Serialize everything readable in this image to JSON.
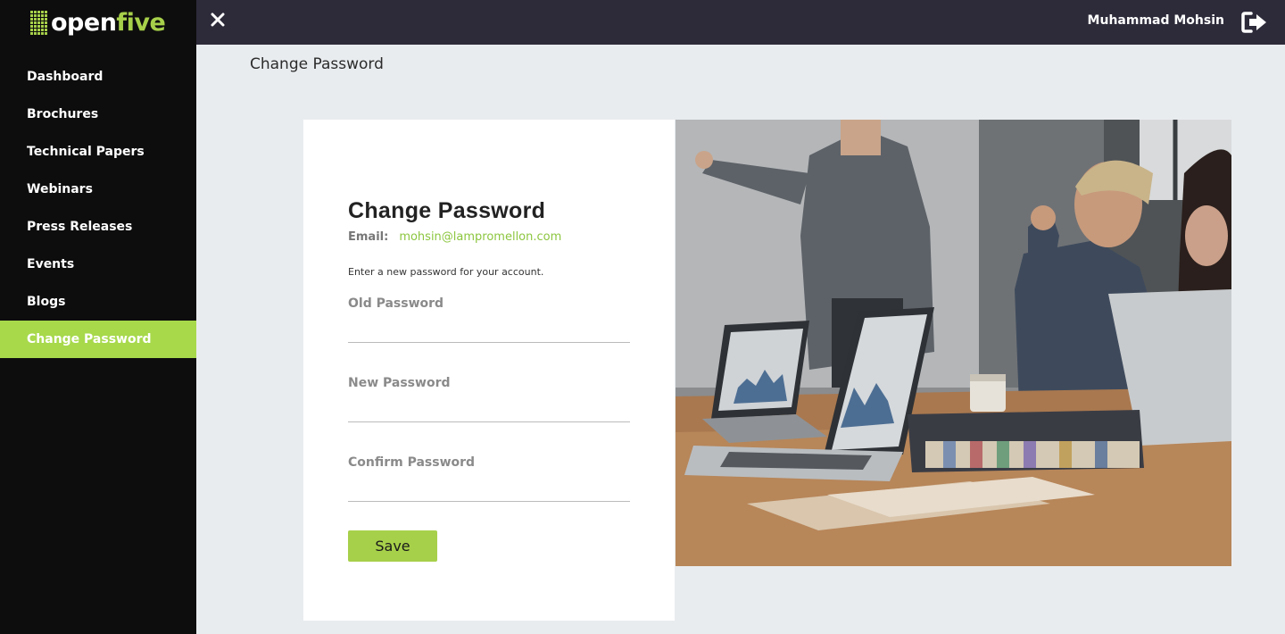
{
  "brand": {
    "name_part1": "open",
    "name_part2": "five",
    "accent": "#a7d04a"
  },
  "sidebar": {
    "items": [
      {
        "label": "Dashboard",
        "active": false
      },
      {
        "label": "Brochures",
        "active": false
      },
      {
        "label": "Technical Papers",
        "active": false
      },
      {
        "label": "Webinars",
        "active": false
      },
      {
        "label": "Press Releases",
        "active": false
      },
      {
        "label": "Events",
        "active": false
      },
      {
        "label": "Blogs",
        "active": false
      },
      {
        "label": "Change Password",
        "active": true
      }
    ]
  },
  "topbar": {
    "close_icon": "close-icon",
    "user_name": "Muhammad Mohsin",
    "logout_icon": "logout-icon"
  },
  "page": {
    "title": "Change Password"
  },
  "form": {
    "title": "Change Password",
    "email_label": "Email:",
    "email_value": "mohsin@lampromellon.com",
    "description": "Enter a new password for your account.",
    "old_password_label": "Old Password",
    "new_password_label": "New Password",
    "confirm_password_label": "Confirm Password",
    "old_password_value": "",
    "new_password_value": "",
    "confirm_password_value": "",
    "save_label": "Save"
  },
  "colors": {
    "sidebar_bg": "#0d0d0d",
    "topbar_bg": "#2d2b3a",
    "active_item": "#a7d94b",
    "email_color": "#8cc63f"
  }
}
